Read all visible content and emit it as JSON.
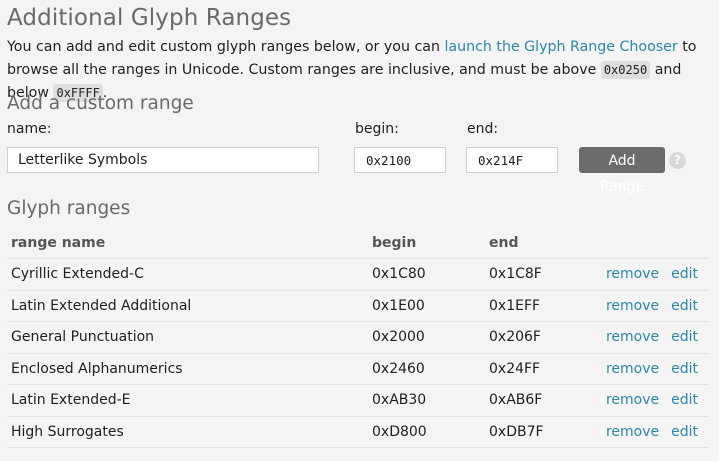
{
  "title": "Additional Glyph Ranges",
  "intro": {
    "text1": "You can add and edit custom glyph ranges below, or you can ",
    "link": "launch the Glyph Range Chooser",
    "text2": " to browse all the ranges in Unicode. Custom ranges are inclusive, and must be above ",
    "code_min": "0x0250",
    "text3": " and below ",
    "code_max": "0xFFFF",
    "text4": "."
  },
  "add_form": {
    "title": "Add a custom range",
    "name_label": "name:",
    "begin_label": "begin:",
    "end_label": "end:",
    "name_value": "Letterlike Symbols",
    "begin_value": "0x2100",
    "end_value": "0x214F",
    "button_label": "Add Range",
    "help_glyph": "?"
  },
  "ranges": {
    "title": "Glyph ranges",
    "headers": {
      "name": "range name",
      "begin": "begin",
      "end": "end"
    },
    "remove_label": "remove",
    "edit_label": "edit",
    "rows": [
      {
        "name": "Cyrillic Extended-C",
        "begin": "0x1C80",
        "end": "0x1C8F"
      },
      {
        "name": "Latin Extended Additional",
        "begin": "0x1E00",
        "end": "0x1EFF"
      },
      {
        "name": "General Punctuation",
        "begin": "0x2000",
        "end": "0x206F"
      },
      {
        "name": "Enclosed Alphanumerics",
        "begin": "0x2460",
        "end": "0x24FF"
      },
      {
        "name": "Latin Extended-E",
        "begin": "0xAB30",
        "end": "0xAB6F"
      },
      {
        "name": "High Surrogates",
        "begin": "0xD800",
        "end": "0xDB7F"
      }
    ]
  }
}
